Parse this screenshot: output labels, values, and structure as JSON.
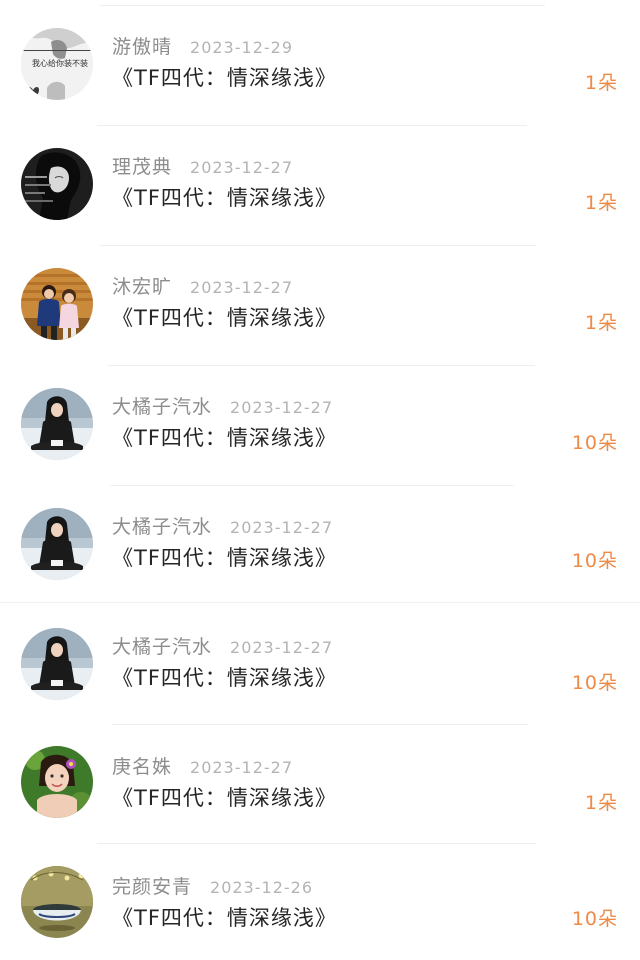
{
  "records": [
    {
      "username": "游傲晴",
      "date": "2023-12-29",
      "title": "《TF四代：情深缘浅》",
      "count": "1朵",
      "avatar": "avatar-bw-text-icon"
    },
    {
      "username": "理茂典",
      "date": "2023-12-27",
      "title": "《TF四代：情深缘浅》",
      "count": "1朵",
      "avatar": "avatar-dark-girl-icon"
    },
    {
      "username": "沐宏旷",
      "date": "2023-12-27",
      "title": "《TF四代：情深缘浅》",
      "count": "1朵",
      "avatar": "avatar-couple-icon"
    },
    {
      "username": "大橘子汽水",
      "date": "2023-12-27",
      "title": "《TF四代：情深缘浅》",
      "count": "10朵",
      "avatar": "avatar-snow-girl-icon"
    },
    {
      "username": "大橘子汽水",
      "date": "2023-12-27",
      "title": "《TF四代：情深缘浅》",
      "count": "10朵",
      "avatar": "avatar-snow-girl-icon"
    },
    {
      "username": "大橘子汽水",
      "date": "2023-12-27",
      "title": "《TF四代：情深缘浅》",
      "count": "10朵",
      "avatar": "avatar-snow-girl-icon"
    },
    {
      "username": "庚名姝",
      "date": "2023-12-27",
      "title": "《TF四代：情深缘浅》",
      "count": "1朵",
      "avatar": "avatar-flower-girl-icon"
    },
    {
      "username": "完颜安青",
      "date": "2023-12-26",
      "title": "《TF四代：情深缘浅》",
      "count": "10朵",
      "avatar": "avatar-teacup-icon"
    }
  ],
  "avatar_text": {
    "line1": "我心给你装不装"
  },
  "colors": {
    "count": "#ef8a46",
    "username": "#8d8d8d",
    "date": "#b4b4b4",
    "title": "#262626"
  }
}
